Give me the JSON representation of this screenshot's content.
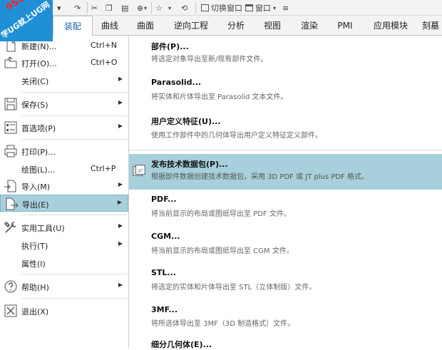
{
  "watermark": {
    "line1": "9SUG",
    "line2": "学UG就上UG网"
  },
  "qat": {
    "switch_window": "切换窗口",
    "window": "窗口"
  },
  "tabs": [
    "装配",
    "曲线",
    "曲面",
    "逆向工程",
    "分析",
    "视图",
    "渲染",
    "PMI",
    "应用模块",
    "刻墓"
  ],
  "menu": {
    "new": {
      "label": "新建(N)...",
      "shortcut": "Ctrl+N"
    },
    "open": {
      "label": "打开(O)...",
      "shortcut": "Ctrl+O"
    },
    "close": {
      "label": "关闭(C)"
    },
    "save": {
      "label": "保存(S)"
    },
    "preferences": {
      "label": "首选项(P)"
    },
    "print": {
      "label": "打印(P)..."
    },
    "plot": {
      "label": "绘图(L)...",
      "shortcut": "Ctrl+P"
    },
    "import": {
      "label": "导入(M)"
    },
    "export": {
      "label": "导出(E)"
    },
    "utilities": {
      "label": "实用工具(U)"
    },
    "execute": {
      "label": "执行(T)"
    },
    "properties": {
      "label": "属性(I)"
    },
    "help": {
      "label": "帮助(H)"
    },
    "exit": {
      "label": "退出(X)"
    }
  },
  "submenu": [
    {
      "title": "部件(P)...",
      "desc": "将选定对象导出至新/现有部件文件。"
    },
    {
      "title": "Parasolid...",
      "desc": "将实体和片体导出至 Parasolid 文本文件。"
    },
    {
      "title": "用户定义特征(U)...",
      "desc": "使用工作部件中的几何体导出用户定义特征定义部件。"
    },
    {
      "title": "发布技术数据包(P)...",
      "desc": "根据部件数据创建技术数据包，采用 3D PDF 或 JT plus PDF 格式。"
    },
    {
      "title": "PDF...",
      "desc": "将当前显示的布局或图纸导出至 PDF 文件。"
    },
    {
      "title": "CGM...",
      "desc": "将当前显示的布局或图纸导出至 CGM 文件。"
    },
    {
      "title": "STL...",
      "desc": "将选定的实体和片体导出至 STL（立体制版）文件。"
    },
    {
      "title": "3MF...",
      "desc": "将所选体导出至 3MF（3D 制造格式）文件。"
    },
    {
      "title": "细分几何体(E)..."
    }
  ]
}
